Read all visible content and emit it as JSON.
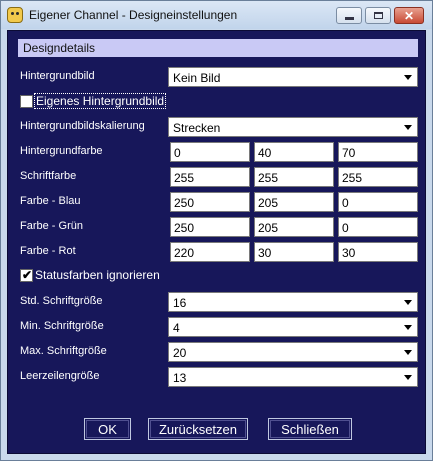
{
  "window": {
    "title": "Eigener Channel - Designeinstellungen",
    "icon": "app-icon",
    "controls": {
      "minimize": "minimize-icon",
      "maximize": "maximize-icon",
      "close": "close-icon"
    }
  },
  "colors": {
    "client_bg": "#17175a",
    "header_bg": "#c9c9f5",
    "text": "#ffffff"
  },
  "group": {
    "title": "Designdetails"
  },
  "background_image": {
    "label": "Hintergrundbild",
    "value": "Kein Bild"
  },
  "own_background": {
    "label": "Eigenes Hintergrundbild",
    "checked": false
  },
  "scaling": {
    "label": "Hintergrundbildskalierung",
    "value": "Strecken"
  },
  "rgb_rows": [
    {
      "label": "Hintergrundfarbe",
      "values": [
        "0",
        "40",
        "70"
      ]
    },
    {
      "label": "Schriftfarbe",
      "values": [
        "255",
        "255",
        "255"
      ]
    },
    {
      "label": "Farbe - Blau",
      "values": [
        "250",
        "205",
        "0"
      ]
    },
    {
      "label": "Farbe - Grün",
      "values": [
        "250",
        "205",
        "0"
      ]
    },
    {
      "label": "Farbe - Rot",
      "values": [
        "220",
        "30",
        "30"
      ]
    }
  ],
  "ignore_status": {
    "label": "Statusfarben ignorieren",
    "checked": true
  },
  "font_sizes": [
    {
      "label": "Std. Schriftgröße",
      "value": "16"
    },
    {
      "label": "Min. Schriftgröße",
      "value": "4"
    },
    {
      "label": "Max. Schriftgröße",
      "value": "20"
    },
    {
      "label": "Leerzeilengröße",
      "value": "13"
    }
  ],
  "buttons": {
    "ok": "OK",
    "reset": "Zurücksetzen",
    "close": "Schließen"
  }
}
